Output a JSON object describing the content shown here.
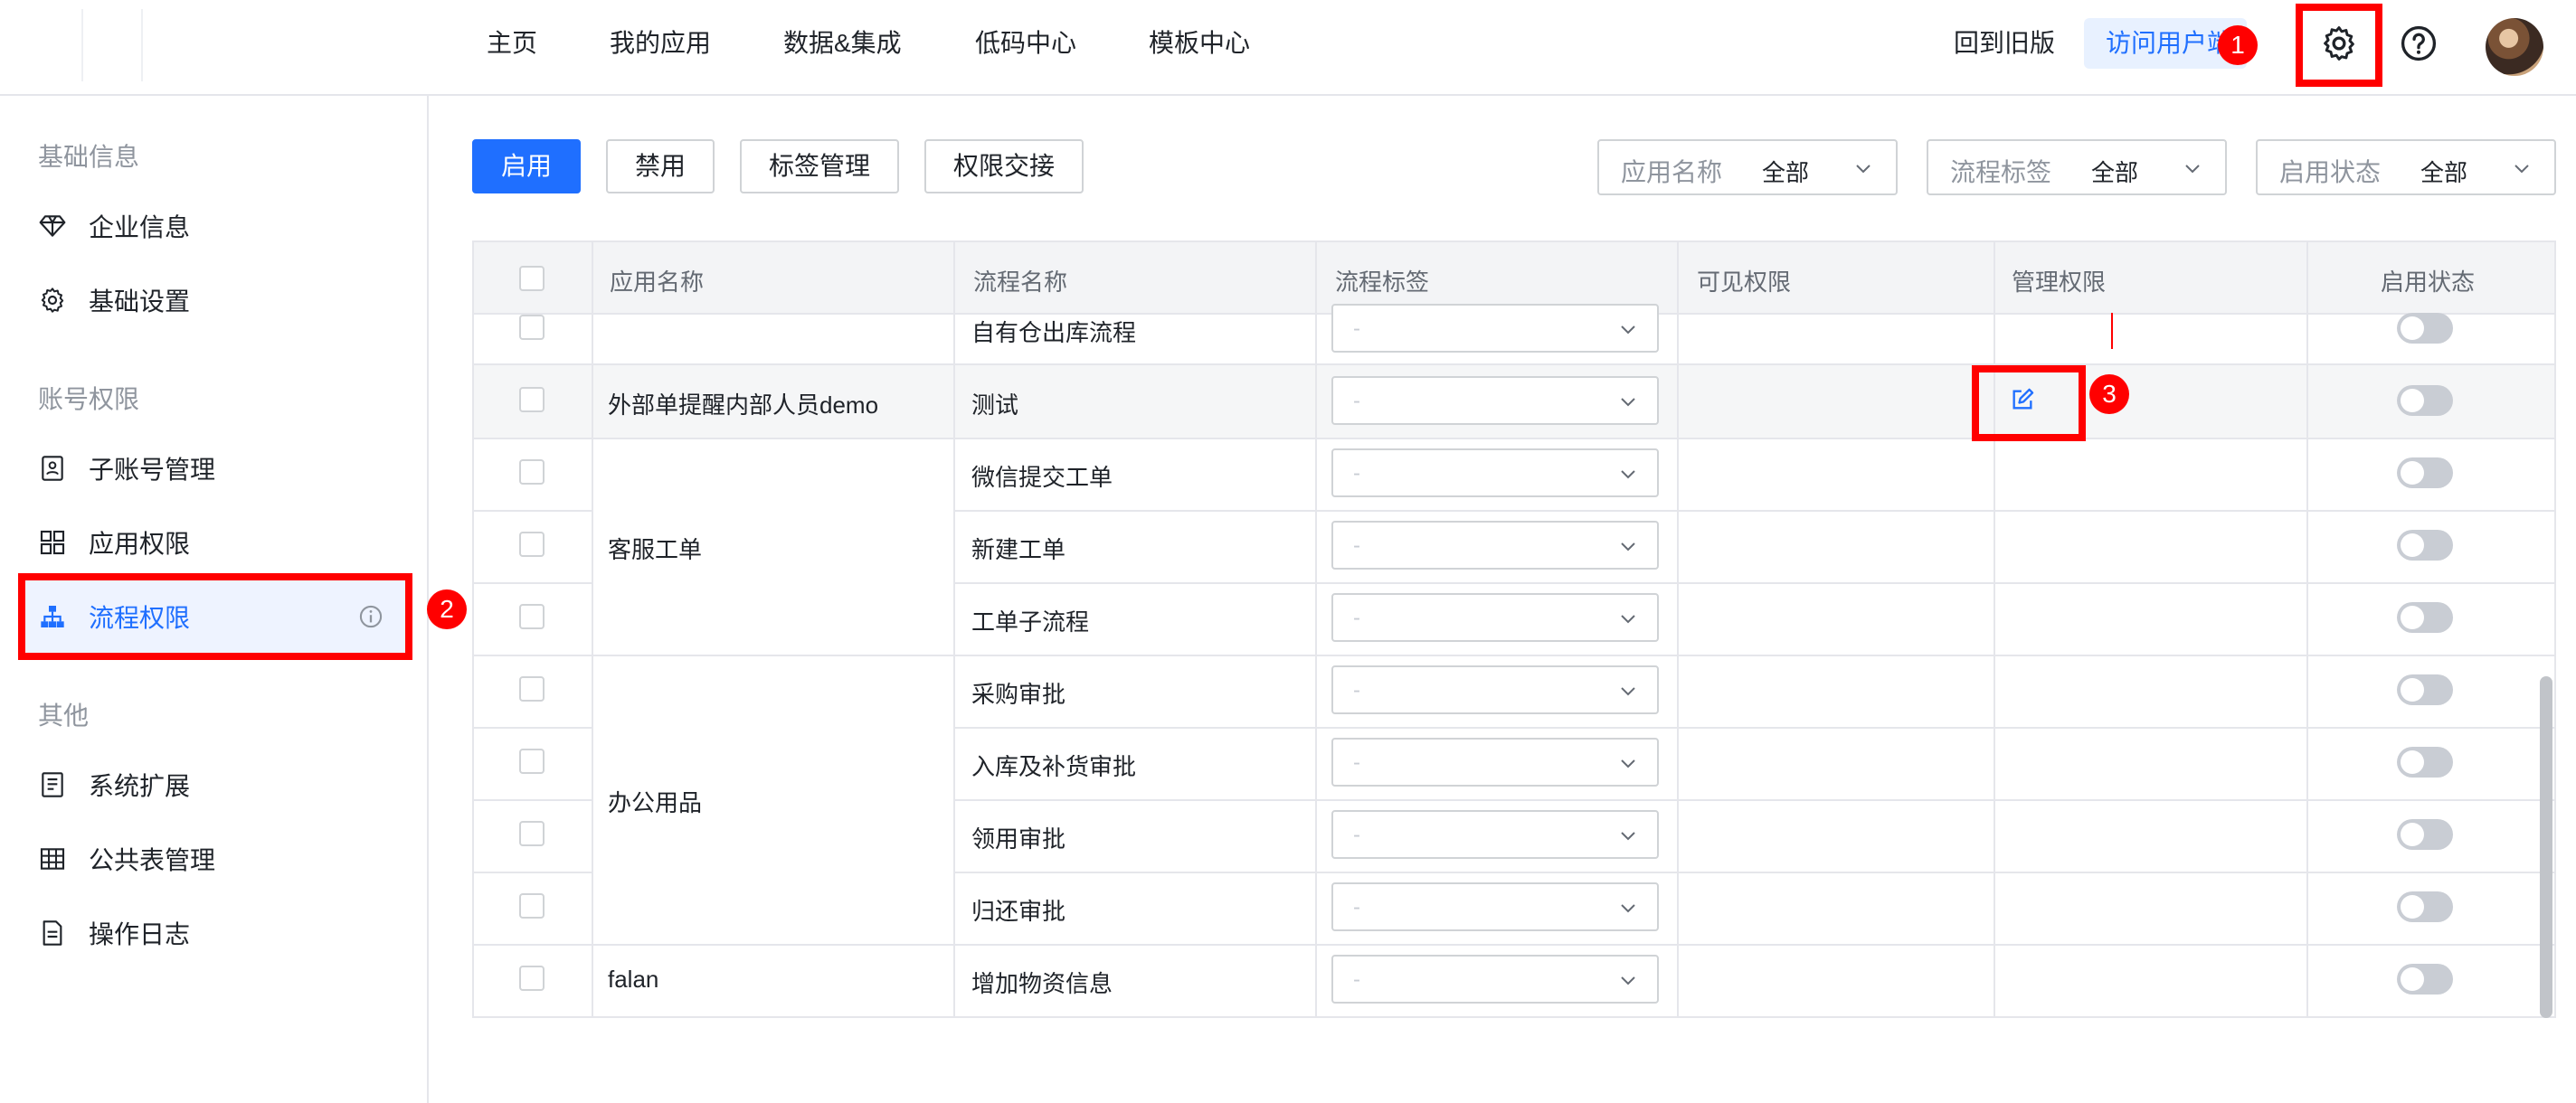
{
  "nav": {
    "items": [
      "主页",
      "我的应用",
      "数据&集成",
      "低码中心",
      "模板中心"
    ],
    "old_version": "回到旧版",
    "visit_user": "访问用户端"
  },
  "sidebar": {
    "groups": [
      {
        "title": "基础信息",
        "items": [
          {
            "label": "企业信息",
            "icon": "diamond-icon"
          },
          {
            "label": "基础设置",
            "icon": "gear-icon"
          }
        ]
      },
      {
        "title": "账号权限",
        "items": [
          {
            "label": "子账号管理",
            "icon": "id-card-icon"
          },
          {
            "label": "应用权限",
            "icon": "grid-icon"
          },
          {
            "label": "流程权限",
            "icon": "org-chart-icon",
            "active": true
          }
        ]
      },
      {
        "title": "其他",
        "items": [
          {
            "label": "系统扩展",
            "icon": "doc-list-icon"
          },
          {
            "label": "公共表管理",
            "icon": "table-icon"
          },
          {
            "label": "操作日志",
            "icon": "file-icon"
          }
        ]
      }
    ]
  },
  "toolbar": {
    "enable": "启用",
    "disable": "禁用",
    "tag_manage": "标签管理",
    "permission_transfer": "权限交接"
  },
  "filters": [
    {
      "label": "应用名称",
      "value": "全部"
    },
    {
      "label": "流程标签",
      "value": "全部"
    },
    {
      "label": "启用状态",
      "value": "全部"
    }
  ],
  "table": {
    "headers": [
      "应用名称",
      "流程名称",
      "流程标签",
      "可见权限",
      "管理权限",
      "启用状态"
    ],
    "select_placeholder": "-",
    "rows": [
      {
        "app": "",
        "flow": "自有仓出库流程"
      },
      {
        "app": "外部单提醒内部人员demo",
        "flow": "测试"
      },
      {
        "app": "",
        "flow": "微信提交工单"
      },
      {
        "app": "客服工单",
        "flow": "新建工单"
      },
      {
        "app": "",
        "flow": "工单子流程"
      },
      {
        "app": "",
        "flow": "采购审批"
      },
      {
        "app": "",
        "flow": "入库及补货审批"
      },
      {
        "app": "办公用品",
        "flow": "领用审批"
      },
      {
        "app": "",
        "flow": "归还审批"
      },
      {
        "app": "falan",
        "flow": "增加物资信息"
      }
    ]
  },
  "annotations": [
    "1",
    "2",
    "3"
  ],
  "colors": {
    "accent": "#1f6fff",
    "annotation": "#ff0000"
  }
}
